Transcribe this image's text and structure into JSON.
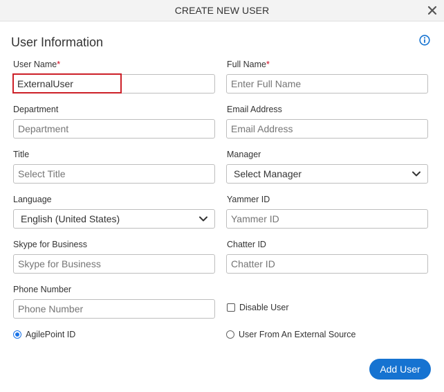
{
  "dialog": {
    "title": "CREATE NEW USER",
    "section_title": "User Information"
  },
  "fields": {
    "user_name": {
      "label": "User Name",
      "required": "*",
      "value": "ExternalUser"
    },
    "full_name": {
      "label": "Full Name",
      "required": "*",
      "placeholder": "Enter Full Name"
    },
    "department": {
      "label": "Department",
      "placeholder": "Department"
    },
    "email": {
      "label": "Email Address",
      "placeholder": "Email Address"
    },
    "title": {
      "label": "Title",
      "placeholder": "Select Title"
    },
    "manager": {
      "label": "Manager",
      "selected": "Select Manager"
    },
    "language": {
      "label": "Language",
      "selected": "English (United States)"
    },
    "yammer": {
      "label": "Yammer ID",
      "placeholder": "Yammer ID"
    },
    "skype": {
      "label": "Skype for Business",
      "placeholder": "Skype for Business"
    },
    "chatter": {
      "label": "Chatter ID",
      "placeholder": "Chatter ID"
    },
    "phone": {
      "label": "Phone Number",
      "placeholder": "Phone Number"
    }
  },
  "disable_user": {
    "label": "Disable User",
    "checked": false
  },
  "source": {
    "agilepoint_label": "AgilePoint ID",
    "external_label": "User From An External Source",
    "selected": "agilepoint"
  },
  "actions": {
    "add_user": "Add User"
  },
  "colors": {
    "accent": "#1673d1",
    "required": "#d0021b",
    "highlight": "#cc1f27"
  },
  "icons": {
    "close": "close-icon",
    "info": "info-icon",
    "chevron": "chevron-down-icon"
  }
}
